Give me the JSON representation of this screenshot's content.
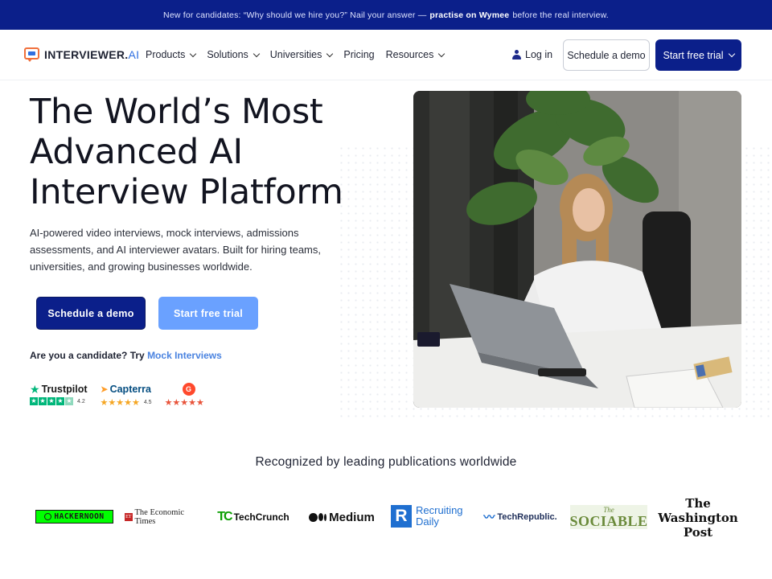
{
  "announcement": {
    "lead": "New for candidates: “Why should we hire you?” Nail your answer —",
    "bold": "practise on Wymee",
    "tail": "before the real interview."
  },
  "nav": {
    "logo_main": "INTERVIEWER.",
    "logo_ai": "AI",
    "items": [
      {
        "label": "Products",
        "dropdown": true
      },
      {
        "label": "Solutions",
        "dropdown": true
      },
      {
        "label": "Universities",
        "dropdown": true
      },
      {
        "label": "Pricing",
        "dropdown": false
      },
      {
        "label": "Resources",
        "dropdown": true
      }
    ],
    "login": "Log in",
    "schedule_demo": "Schedule a demo",
    "start_trial": "Start free trial"
  },
  "hero": {
    "title_lines": [
      "The World’s Most",
      "Advanced AI",
      "Interview Platform"
    ],
    "subtitle": "AI-powered video interviews, mock interviews, admissions assessments, and AI interviewer avatars. Built for hiring teams, universities, and growing businesses worldwide.",
    "btn_demo": "Schedule a demo",
    "btn_trial": "Start free trial",
    "candidate_text": "Are you a candidate? Try",
    "candidate_link": "Mock Interviews"
  },
  "ratings": {
    "trustpilot": {
      "name": "Trustpilot",
      "score": "4.2",
      "stars": 4
    },
    "capterra": {
      "name": "Capterra",
      "score": "4.5",
      "stars": 4.5
    },
    "g2": {
      "name": "G",
      "stars": 4.5
    }
  },
  "publications": {
    "title": "Recognized by leading publications worldwide",
    "hackernoon": "HACKERNOON",
    "economic_times": "The Economic Times",
    "techcrunch": "TechCrunch",
    "medium": "Medium",
    "recruiting_daily_1": "Recruiting",
    "recruiting_daily_2": "Daily",
    "techrepublic": "TechRepublic.",
    "sociable_1": "The",
    "sociable_2": "SOCIABLE",
    "wapo_1": "The",
    "wapo_2": "Washington",
    "wapo_3": "Post"
  },
  "colors": {
    "brand_navy": "#0b1f8a",
    "brand_light_blue": "#6aa1ff",
    "link_blue": "#4a83e0"
  }
}
